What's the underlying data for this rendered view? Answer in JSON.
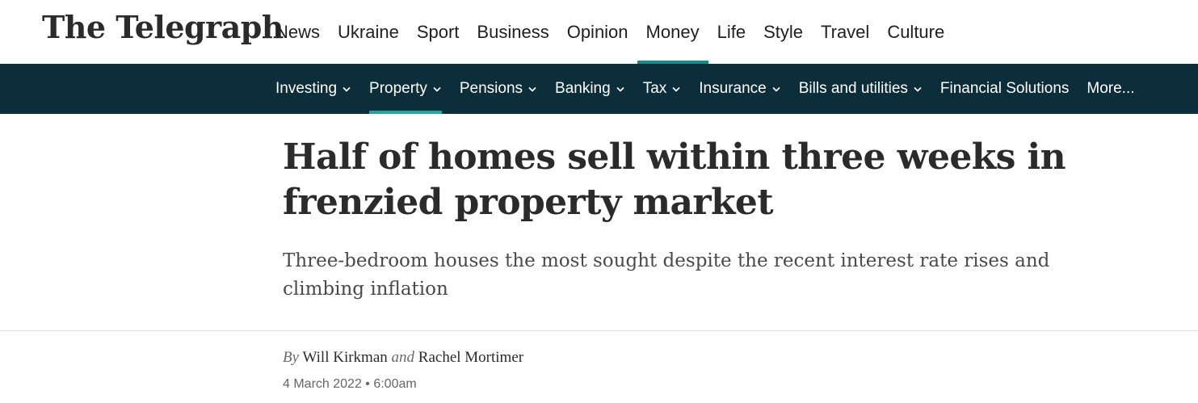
{
  "masthead": {
    "logo_text": "The Telegraph",
    "primary_nav": [
      {
        "label": "News"
      },
      {
        "label": "Ukraine"
      },
      {
        "label": "Sport"
      },
      {
        "label": "Business"
      },
      {
        "label": "Opinion"
      },
      {
        "label": "Money",
        "active": true
      },
      {
        "label": "Life"
      },
      {
        "label": "Style"
      },
      {
        "label": "Travel"
      },
      {
        "label": "Culture"
      }
    ],
    "active_underline_color": "#198a8a"
  },
  "secondary_nav": {
    "background_color": "#0b2e3a",
    "items": [
      {
        "label": "Investing",
        "has_dropdown": true
      },
      {
        "label": "Property",
        "has_dropdown": true,
        "active": true
      },
      {
        "label": "Pensions",
        "has_dropdown": true
      },
      {
        "label": "Banking",
        "has_dropdown": true
      },
      {
        "label": "Tax",
        "has_dropdown": true
      },
      {
        "label": "Insurance",
        "has_dropdown": true
      },
      {
        "label": "Bills and utilities",
        "has_dropdown": true
      },
      {
        "label": "Financial Solutions",
        "has_dropdown": false
      },
      {
        "label": "More...",
        "has_dropdown": false
      }
    ],
    "dropdown_icon": "chevron-down-icon"
  },
  "article": {
    "headline": "Half of homes sell within three weeks in frenzied property market",
    "standfirst": "Three-bedroom houses the most sought despite the recent interest rate rises and climbing inflation",
    "byline": {
      "prefix": "By",
      "author_1": "Will Kirkman",
      "conjunction": "and",
      "author_2": "Rachel Mortimer"
    },
    "dateline": "4 March 2022 • 6:00am"
  }
}
